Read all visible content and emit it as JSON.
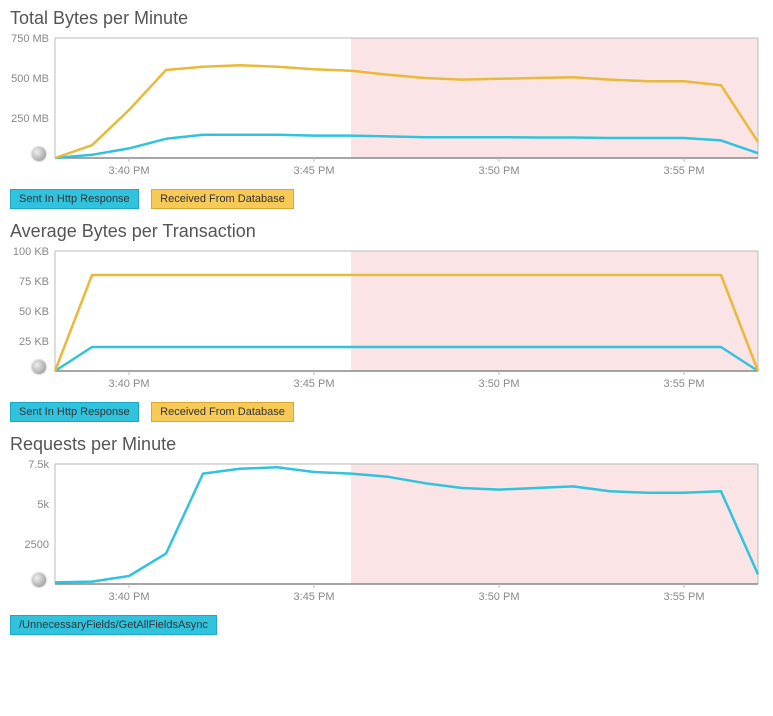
{
  "colors": {
    "teal": "#31c3dd",
    "gold": "#e9b93a",
    "band": "#fbe4e6"
  },
  "legends": {
    "http": "Sent In Http Response",
    "db": "Received From Database",
    "endpoint": "/UnnecessaryFields/GetAllFieldsAsync"
  },
  "chart_data": [
    {
      "id": "total-bytes",
      "title": "Total Bytes per Minute",
      "type": "line",
      "xlabel": "",
      "ylabel": "",
      "ylim": [
        0,
        750
      ],
      "y_unit": "MB",
      "y_ticks": [
        250,
        500,
        750
      ],
      "y_tick_labels": [
        "250 MB",
        "500 MB",
        "750 MB"
      ],
      "x": [
        "3:38",
        "3:39",
        "3:40",
        "3:41",
        "3:42",
        "3:43",
        "3:44",
        "3:45",
        "3:46",
        "3:47",
        "3:48",
        "3:49",
        "3:50",
        "3:51",
        "3:52",
        "3:53",
        "3:54",
        "3:55",
        "3:56",
        "3:57"
      ],
      "x_ticks": [
        "3:40 PM",
        "3:45 PM",
        "3:50 PM",
        "3:55 PM"
      ],
      "x_tick_idx": [
        2,
        7,
        12,
        17
      ],
      "highlight_from_idx": 8,
      "series": [
        {
          "name": "Sent In Http Response",
          "color": "teal",
          "values": [
            0,
            20,
            60,
            120,
            145,
            145,
            145,
            140,
            140,
            135,
            130,
            130,
            130,
            128,
            128,
            125,
            125,
            125,
            110,
            30
          ]
        },
        {
          "name": "Received From Database",
          "color": "gold",
          "values": [
            0,
            80,
            300,
            550,
            570,
            580,
            570,
            555,
            545,
            520,
            500,
            490,
            495,
            500,
            505,
            490,
            480,
            480,
            455,
            100
          ]
        }
      ]
    },
    {
      "id": "avg-bytes",
      "title": "Average Bytes per Transaction",
      "type": "line",
      "xlabel": "",
      "ylabel": "",
      "ylim": [
        0,
        100
      ],
      "y_unit": "KB",
      "y_ticks": [
        25,
        50,
        75,
        100
      ],
      "y_tick_labels": [
        "25 KB",
        "50 KB",
        "75 KB",
        "100 KB"
      ],
      "x": [
        "3:38",
        "3:39",
        "3:40",
        "3:41",
        "3:42",
        "3:43",
        "3:44",
        "3:45",
        "3:46",
        "3:47",
        "3:48",
        "3:49",
        "3:50",
        "3:51",
        "3:52",
        "3:53",
        "3:54",
        "3:55",
        "3:56",
        "3:57"
      ],
      "x_ticks": [
        "3:40 PM",
        "3:45 PM",
        "3:50 PM",
        "3:55 PM"
      ],
      "x_tick_idx": [
        2,
        7,
        12,
        17
      ],
      "highlight_from_idx": 8,
      "series": [
        {
          "name": "Sent In Http Response",
          "color": "teal",
          "values": [
            0,
            20,
            20,
            20,
            20,
            20,
            20,
            20,
            20,
            20,
            20,
            20,
            20,
            20,
            20,
            20,
            20,
            20,
            20,
            0
          ]
        },
        {
          "name": "Received From Database",
          "color": "gold",
          "values": [
            0,
            80,
            80,
            80,
            80,
            80,
            80,
            80,
            80,
            80,
            80,
            80,
            80,
            80,
            80,
            80,
            80,
            80,
            80,
            0
          ]
        }
      ]
    },
    {
      "id": "requests",
      "title": "Requests per Minute",
      "type": "line",
      "xlabel": "",
      "ylabel": "",
      "ylim": [
        0,
        7500
      ],
      "y_unit": "",
      "y_ticks": [
        2500,
        5000,
        7500
      ],
      "y_tick_labels": [
        "2500",
        "5k",
        "7.5k"
      ],
      "x": [
        "3:38",
        "3:39",
        "3:40",
        "3:41",
        "3:42",
        "3:43",
        "3:44",
        "3:45",
        "3:46",
        "3:47",
        "3:48",
        "3:49",
        "3:50",
        "3:51",
        "3:52",
        "3:53",
        "3:54",
        "3:55",
        "3:56",
        "3:57"
      ],
      "x_ticks": [
        "3:40 PM",
        "3:45 PM",
        "3:50 PM",
        "3:55 PM"
      ],
      "x_tick_idx": [
        2,
        7,
        12,
        17
      ],
      "highlight_from_idx": 8,
      "series": [
        {
          "name": "/UnnecessaryFields/GetAllFieldsAsync",
          "color": "teal",
          "values": [
            100,
            150,
            500,
            1900,
            6900,
            7200,
            7300,
            7000,
            6900,
            6700,
            6300,
            6000,
            5900,
            6000,
            6100,
            5800,
            5700,
            5700,
            5800,
            600
          ]
        }
      ]
    }
  ]
}
